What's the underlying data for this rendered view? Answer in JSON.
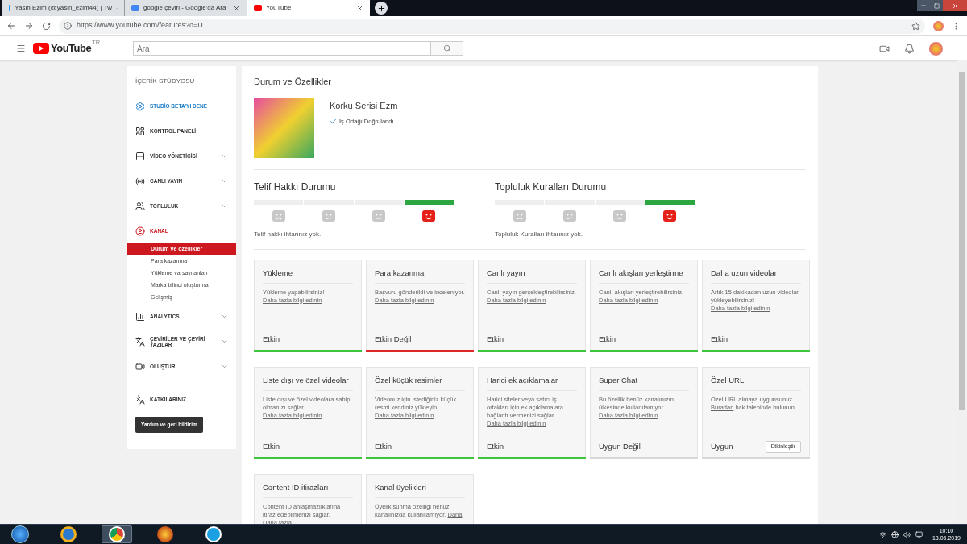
{
  "browser": {
    "tabs": [
      {
        "title": "Yasin Ezim (@yasin_ezim44) | Tw",
        "selected": false
      },
      {
        "title": "google çeviri - Google'da Ara",
        "selected": false
      },
      {
        "title": "YouTube",
        "selected": true
      }
    ],
    "url": "https://www.youtube.com/features?o=U"
  },
  "header": {
    "logo": "YouTube",
    "region": "TR",
    "search": {
      "placeholder": "Ara"
    }
  },
  "sidebar": {
    "title": "İÇERİK STÜDYOSU",
    "items": [
      {
        "label": "STUDİO BETA'YI DENE",
        "kind": "promo",
        "expandable": false,
        "selected": false
      },
      {
        "label": "KONTROL PANELİ",
        "kind": "nav",
        "expandable": false,
        "selected": false
      },
      {
        "label": "VİDEO YÖNETİCİSİ",
        "kind": "nav",
        "expandable": true,
        "selected": false
      },
      {
        "label": "CANLI YAYIN",
        "kind": "nav",
        "expandable": true,
        "selected": false
      },
      {
        "label": "TOPLULUK",
        "kind": "nav",
        "expandable": true,
        "selected": false
      },
      {
        "label": "KANAL",
        "kind": "nav",
        "expandable": false,
        "selected": true,
        "children": [
          {
            "label": "Durum ve özellikler",
            "selected": true
          },
          {
            "label": "Para kazanma",
            "selected": false
          },
          {
            "label": "Yükleme varsayılanları",
            "selected": false
          },
          {
            "label": "Marka bilinci oluşturma",
            "selected": false
          },
          {
            "label": "Gelişmiş",
            "selected": false
          }
        ]
      },
      {
        "label": "ANALYTİCS",
        "kind": "nav",
        "expandable": true,
        "selected": false
      },
      {
        "label": "ÇEVİRİLER VE ÇEVİRİ YAZILAR",
        "kind": "nav",
        "expandable": true,
        "selected": false
      },
      {
        "label": "OLUŞTUR",
        "kind": "nav",
        "expandable": true,
        "selected": false
      }
    ],
    "secondary_items": [
      {
        "label": "KATKILARINIZ"
      }
    ],
    "help_button": "Yardım ve geri bildirim"
  },
  "main": {
    "title": "Durum ve Özellikler",
    "channel": {
      "name": "Korku Serisi Ezm",
      "badge": "İş Ortağı Doğrulandı"
    },
    "statuses": [
      {
        "title": "Telif Hakkı Durumu",
        "segments": [
          {
            "kind": "sad",
            "selected": false
          },
          {
            "kind": "unhappy",
            "selected": false
          },
          {
            "kind": "neutral",
            "selected": false
          },
          {
            "kind": "happy",
            "selected": true
          }
        ],
        "note": "Telif hakkı ihtarınız yok."
      },
      {
        "title": "Topluluk Kuralları Durumu",
        "segments": [
          {
            "kind": "sad",
            "selected": false
          },
          {
            "kind": "unhappy",
            "selected": false
          },
          {
            "kind": "neutral",
            "selected": false
          },
          {
            "kind": "happy",
            "selected": true
          }
        ],
        "note": "Topluluk Kuralları ihtarınız yok."
      }
    ],
    "features": [
      {
        "title": "Yükleme",
        "description": "Yükleme yapabilirsiniz!",
        "link": "Daha fazla bilgi edinin",
        "status": "Etkin",
        "color": "#3ec53e"
      },
      {
        "title": "Para kazanma",
        "description": "Başvuru gönderildi ve inceleniyor.",
        "link": "Daha fazla bilgi edinin",
        "status": "Etkin Değil",
        "color": "#e02828"
      },
      {
        "title": "Canlı yayın",
        "description": "Canlı yayın gerçekleştirebilirsiniz.",
        "link": "Daha fazla bilgi edinin",
        "status": "Etkin",
        "color": "#3ec53e"
      },
      {
        "title": "Canlı akışları yerleştirme",
        "description": "Canlı akışları yerleştirebilirsiniz.",
        "link": "Daha fazla bilgi edinin",
        "status": "Etkin",
        "color": "#3ec53e"
      },
      {
        "title": "Daha uzun videolar",
        "description": "Artık 15 dakikadan uzun videolar yükleyebilirsiniz!",
        "link": "Daha fazla bilgi edinin",
        "status": "Etkin",
        "color": "#3ec53e"
      },
      {
        "title": "Liste dışı ve özel videolar",
        "description": "Liste dışı ve özel videolara sahip olmanızı sağlar.",
        "link": "Daha fazla bilgi edinin",
        "status": "Etkin",
        "color": "#3ec53e"
      },
      {
        "title": "Özel küçük resimler",
        "description": "Videonuz için istediğiniz küçük resmi kendiniz yükleyin.",
        "link": "Daha fazla bilgi edinin",
        "status": "Etkin",
        "color": "#3ec53e"
      },
      {
        "title": "Harici ek açıklamalar",
        "description": "Harici siteler veya satıcı iş ortakları için ek açıklamalara bağlantı vermenizi sağlar.",
        "link": "Daha fazla bilgi edinin",
        "status": "Etkin",
        "color": "#3ec53e"
      },
      {
        "title": "Super Chat",
        "description": "Bu özellik henüz kanalınızın ülkesinde kullanılamıyor.",
        "link": "Daha fazla bilgi edinin",
        "status": "Uygun Değil",
        "color": "#d8d8d8"
      },
      {
        "title": "Özel URL",
        "description": "Özel URL almaya uygunsunuz.",
        "link": "Buradan",
        "after": " hak talebinde bulunun.",
        "status": "Uygun",
        "color": "#d8d8d8",
        "action": "Etkinleştir"
      },
      {
        "title": "Content ID itirazları",
        "description": "Content ID anlaşmazlıklarına itiraz edebilmenizi sağlar.",
        "link": "Daha fazla"
      },
      {
        "title": "Kanal üyelikleri",
        "description": "Üyelik sunma özelliği henüz kanalınızda kullanılamıyor.",
        "link": "Daha"
      }
    ]
  },
  "taskbar": {
    "apps": [
      {
        "selected": false
      },
      {
        "selected": false
      },
      {
        "selected": true
      },
      {
        "selected": false
      },
      {
        "selected": false
      }
    ],
    "time": "10:10",
    "date": "13.05.2019"
  }
}
